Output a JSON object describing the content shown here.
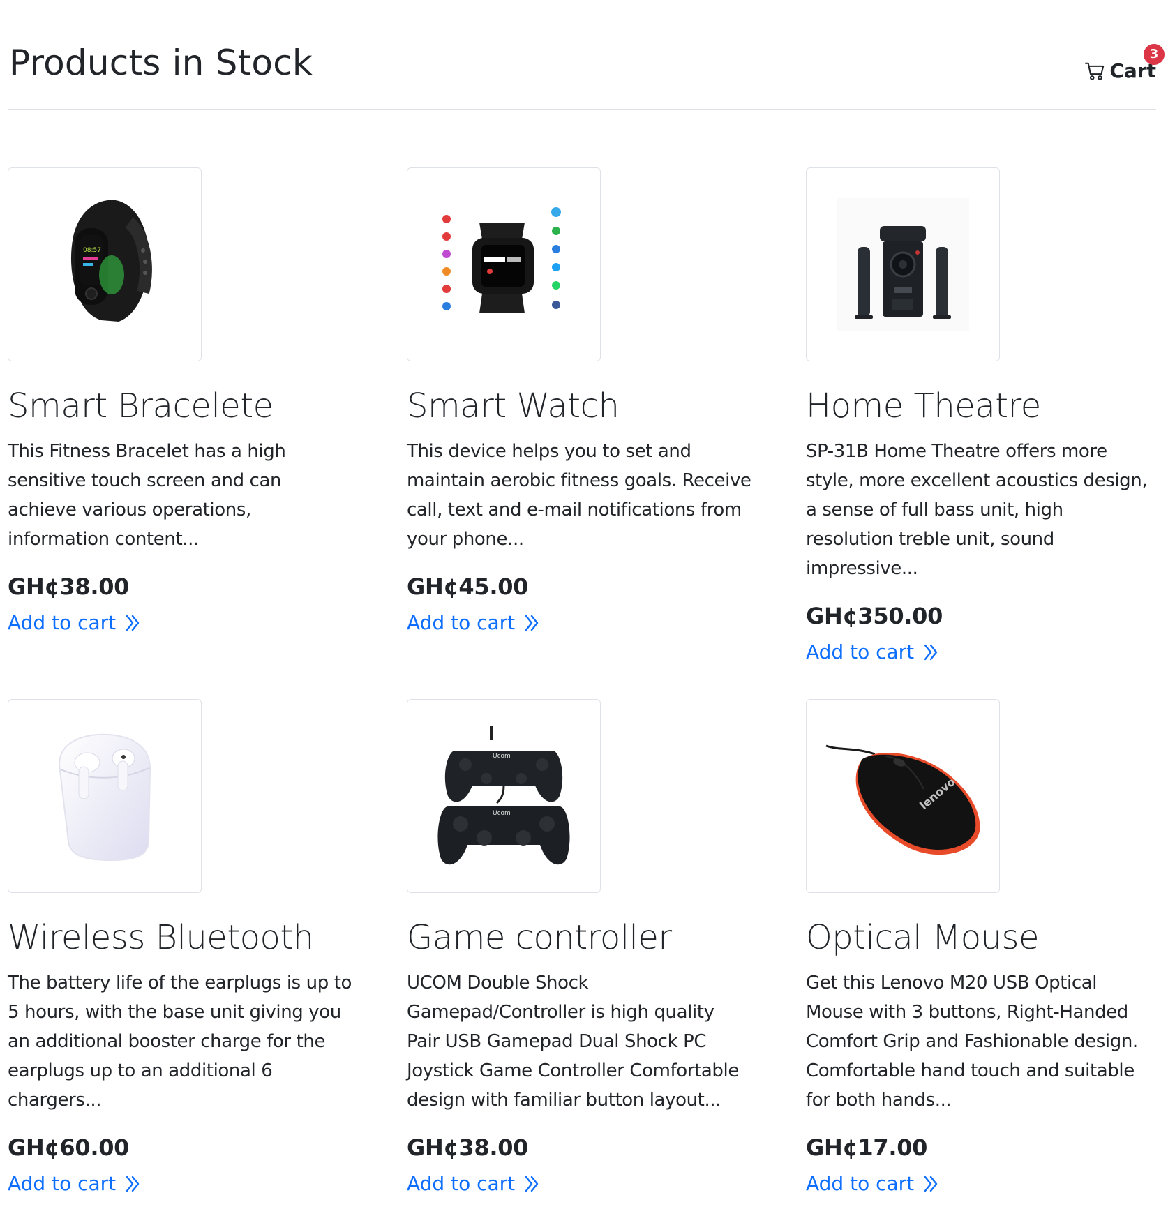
{
  "page": {
    "title": "Products in Stock"
  },
  "cart": {
    "label": "Cart",
    "count": "3",
    "icon": "cart-icon",
    "badge_color": "#dc3545"
  },
  "colors": {
    "link": "#0d6efd",
    "text": "#212529",
    "border": "#dee2e6"
  },
  "products": [
    {
      "name": "Smart Bracelete",
      "description": "This Fitness Bracelet has a high sensitive touch screen and can achieve various operations, information content...",
      "price": "GH¢38.00",
      "cta": "Add to cart",
      "image": "fitness-bracelet-image"
    },
    {
      "name": "Smart Watch",
      "description": "This device helps you to set and maintain aerobic fitness goals. Receive call, text and e-mail notifications from your phone...",
      "price": "GH¢45.00",
      "cta": "Add to cart",
      "image": "smart-watch-image"
    },
    {
      "name": "Home Theatre",
      "description": "SP-31B Home Theatre offers more style, more excellent acoustics design, a sense of full bass unit, high resolution treble unit, sound impressive...",
      "price": "GH¢350.00",
      "cta": "Add to cart",
      "image": "home-theatre-image"
    },
    {
      "name": "Wireless Bluetooth",
      "description": "The battery life of the earplugs is up to 5 hours, with the base unit giving you an additional booster charge for the earplugs up to an additional 6 chargers...",
      "price": "GH¢60.00",
      "cta": "Add to cart",
      "image": "earbuds-image"
    },
    {
      "name": "Game controller",
      "description": "UCOM Double Shock Gamepad/Controller is high quality Pair USB Gamepad Dual Shock PC Joystick Game Controller Comfortable design with familiar button layout...",
      "price": "GH¢38.00",
      "cta": "Add to cart",
      "image": "game-controller-image"
    },
    {
      "name": "Optical Mouse",
      "description": "Get this Lenovo M20 USB Optical Mouse with 3 buttons, Right-Handed Comfort Grip and Fashionable design. Comfortable hand touch and suitable for both hands...",
      "price": "GH¢17.00",
      "cta": "Add to cart",
      "image": "optical-mouse-image"
    }
  ],
  "image_text": {
    "bracelet_time": "08:57",
    "controller_brand": "Ucom",
    "mouse_brand": "lenovo"
  }
}
